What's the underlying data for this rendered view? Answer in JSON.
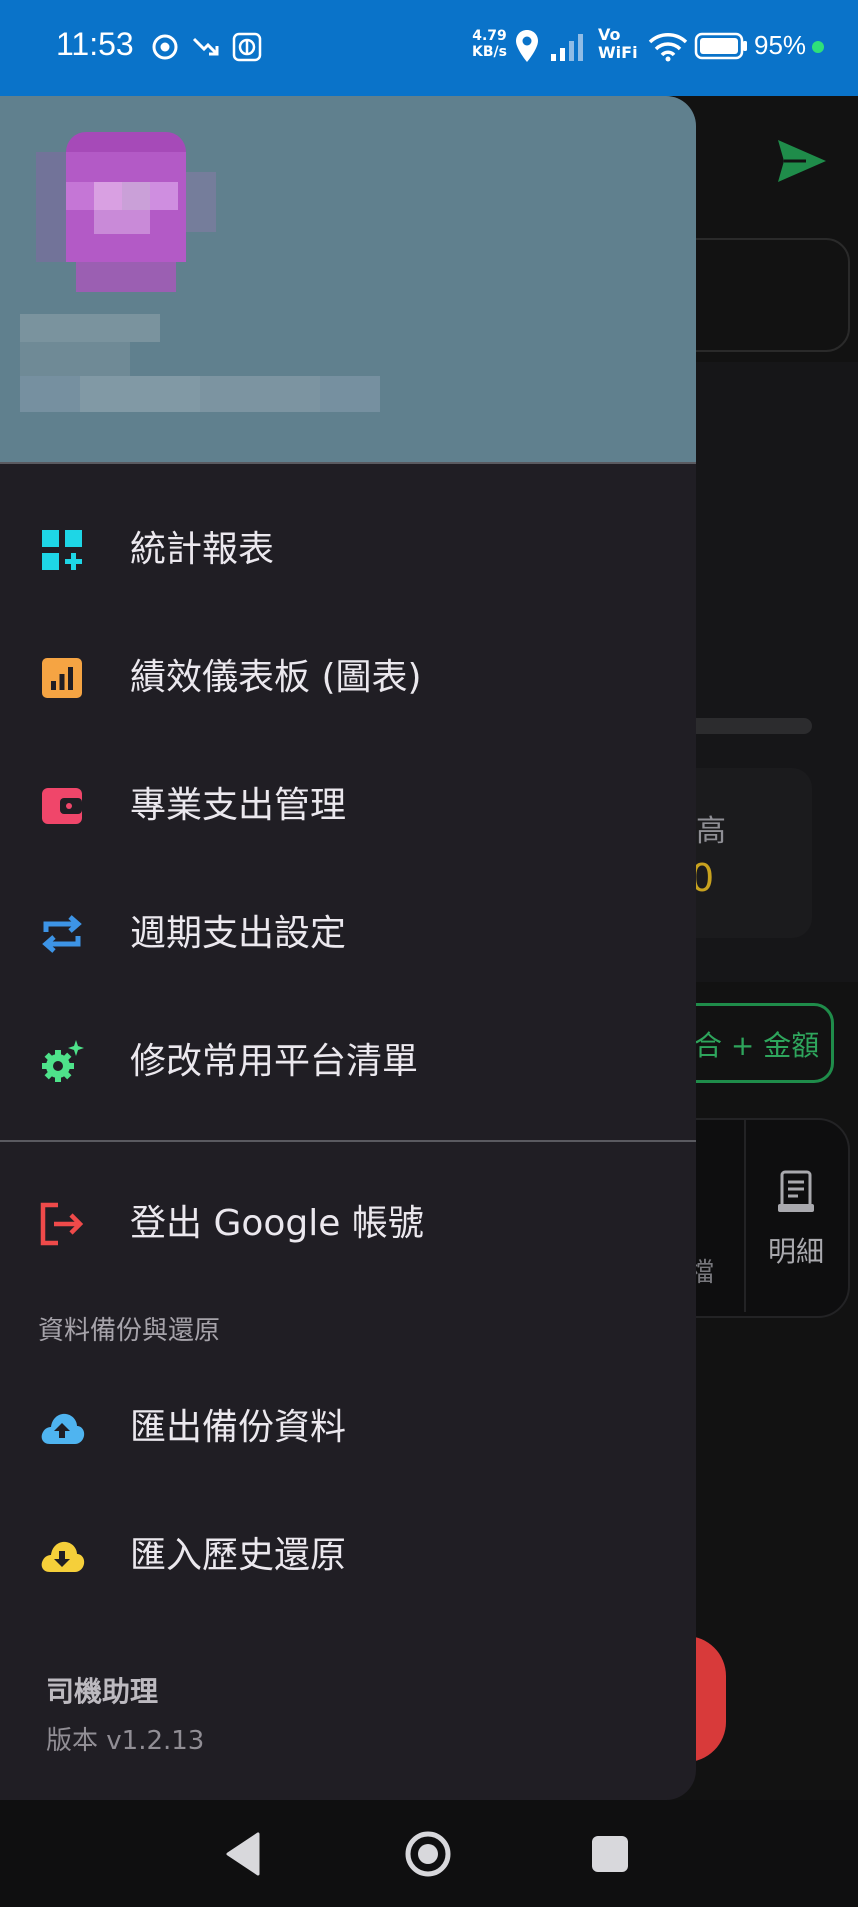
{
  "status_bar": {
    "time": "11:53",
    "net_speed_value": "4.79",
    "net_speed_unit": "KB/s",
    "vowifi_top": "Vo",
    "vowifi_bottom": "WiFi",
    "battery_percent": "95%"
  },
  "drawer": {
    "menu": [
      {
        "label": "統計報表",
        "icon": "dashboard-add-icon",
        "color": "#1ed6e6"
      },
      {
        "label": "績效儀表板 (圖表)",
        "icon": "bar-chart-icon",
        "color": "#f5a443"
      },
      {
        "label": "專業支出管理",
        "icon": "wallet-icon",
        "color": "#f0466a"
      },
      {
        "label": "週期支出設定",
        "icon": "repeat-icon",
        "color": "#3d94e6"
      },
      {
        "label": "修改常用平台清單",
        "icon": "gear-sparkle-icon",
        "color": "#4ee28a"
      }
    ],
    "logout_label": "登出 Google 帳號",
    "backup_section_label": "資料備份與還原",
    "backup_items": [
      {
        "label": "匯出備份資料",
        "icon": "cloud-upload-icon",
        "color": "#4fb4f0"
      },
      {
        "label": "匯入歷史還原",
        "icon": "cloud-download-icon",
        "color": "#f5cf3a"
      }
    ],
    "app_name": "司機助理",
    "app_version": "版本 v1.2.13"
  },
  "background_app": {
    "card_label": "高",
    "card_value": "0",
    "amount_button_label": "合 + 金額",
    "tab_detail_label": "明細",
    "tab_partial_label": "檔"
  },
  "colors": {
    "status_bar": "#0a73c9",
    "drawer_bg": "#201e24",
    "header_bg": "#60808e",
    "accent_green": "#1f8c4a"
  }
}
